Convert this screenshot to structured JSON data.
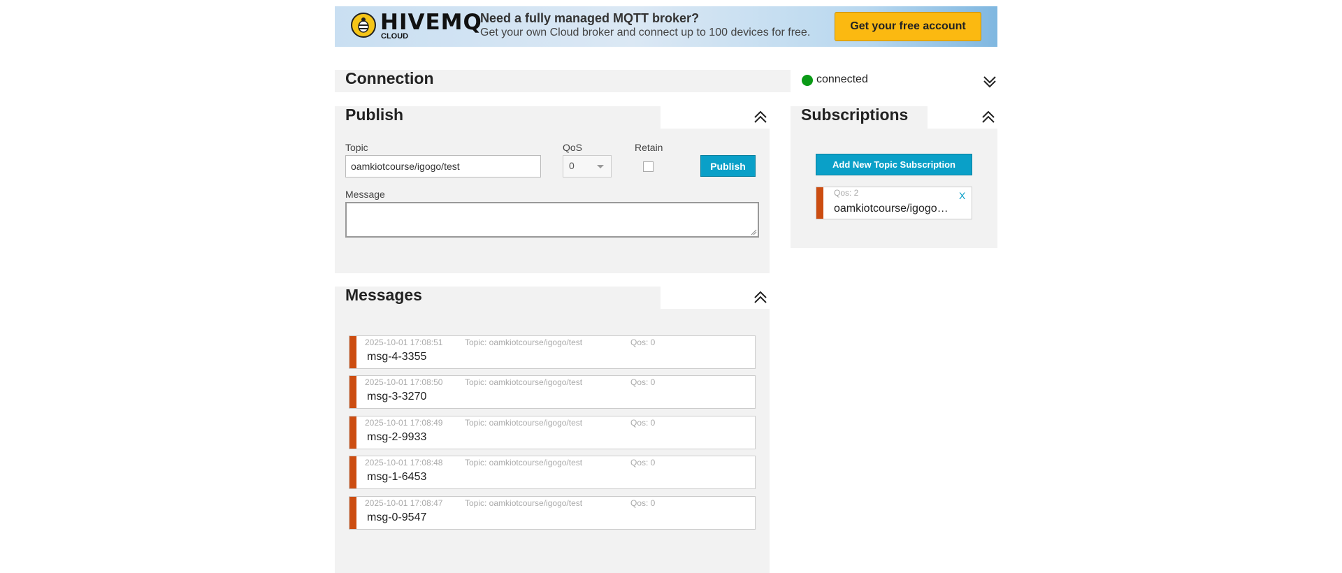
{
  "banner": {
    "logo_text": "HIVEMQ",
    "logo_sub": "CLOUD",
    "title": "Need a fully managed MQTT broker?",
    "subtitle": "Get your own Cloud broker and connect up to 100 devices for free.",
    "cta_label": "Get your free account",
    "colors": {
      "cta": "#fbb911",
      "gradient_end": "#7fb7e0"
    }
  },
  "connection": {
    "title": "Connection",
    "status": "connected",
    "status_color": "#0a9a16",
    "toggle_icon": "double-chevron-down-icon"
  },
  "publish": {
    "title": "Publish",
    "topic_label": "Topic",
    "topic_value": "oamkiotcourse/igogo/test",
    "qos_label": "QoS",
    "qos_value": "0",
    "retain_label": "Retain",
    "retain_checked": false,
    "button_label": "Publish",
    "message_label": "Message",
    "message_value": "",
    "toggle_icon": "double-chevron-up-icon"
  },
  "subscriptions": {
    "title": "Subscriptions",
    "add_button_label": "Add New Topic Subscription",
    "toggle_icon": "double-chevron-up-icon",
    "items": [
      {
        "qos": "Qos: 2",
        "topic": "oamkiotcourse/igogo/test",
        "close": "X",
        "color": "#cc4d11"
      }
    ]
  },
  "messages": {
    "title": "Messages",
    "toggle_icon": "double-chevron-up-icon",
    "items": [
      {
        "date": "2025-10-01 17:08:51",
        "topic": "Topic: oamkiotcourse/igogo/test",
        "qos": "Qos: 0",
        "payload": "msg-4-3355"
      },
      {
        "date": "2025-10-01 17:08:50",
        "topic": "Topic: oamkiotcourse/igogo/test",
        "qos": "Qos: 0",
        "payload": "msg-3-3270"
      },
      {
        "date": "2025-10-01 17:08:49",
        "topic": "Topic: oamkiotcourse/igogo/test",
        "qos": "Qos: 0",
        "payload": "msg-2-9933"
      },
      {
        "date": "2025-10-01 17:08:48",
        "topic": "Topic: oamkiotcourse/igogo/test",
        "qos": "Qos: 0",
        "payload": "msg-1-6453"
      },
      {
        "date": "2025-10-01 17:08:47",
        "topic": "Topic: oamkiotcourse/igogo/test",
        "qos": "Qos: 0",
        "payload": "msg-0-9547"
      }
    ]
  },
  "accent_color": "#0aa0c8"
}
